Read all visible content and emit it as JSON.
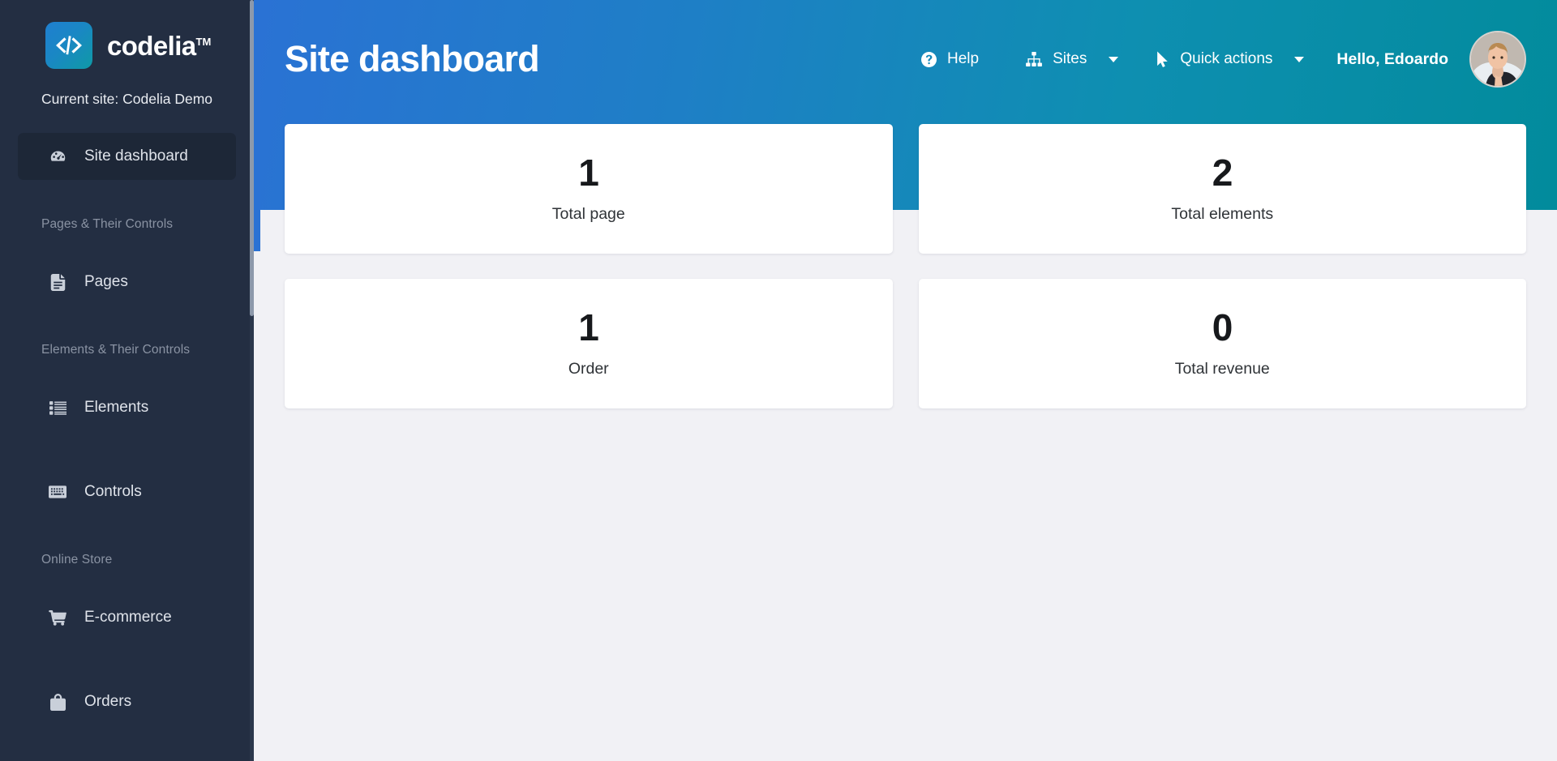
{
  "sidebar": {
    "logo": {
      "text": "codelia",
      "tm": "TM",
      "icon": "code-brackets-icon"
    },
    "current_site": "Current site: Codelia Demo",
    "primary_item": {
      "label": "Site dashboard",
      "icon": "gauge-icon",
      "active": true
    },
    "groups": [
      {
        "title": "Pages & Their Controls",
        "items": [
          {
            "label": "Pages",
            "icon": "document-icon"
          }
        ]
      },
      {
        "title": "Elements & Their Controls",
        "items": [
          {
            "label": "Elements",
            "icon": "list-icon"
          },
          {
            "label": "Controls",
            "icon": "keyboard-icon"
          }
        ]
      },
      {
        "title": "Online Store",
        "items": [
          {
            "label": "E-commerce",
            "icon": "shopping-cart-icon"
          },
          {
            "label": "Orders",
            "icon": "shopping-bag-icon"
          }
        ]
      }
    ]
  },
  "header": {
    "title": "Site dashboard",
    "help": {
      "label": "Help",
      "icon": "question-circle-icon"
    },
    "sites": {
      "label": "Sites",
      "icon": "sitemap-icon",
      "caret": "chevron-down-icon"
    },
    "quick_actions": {
      "label": "Quick actions",
      "icon": "cursor-arrow-icon",
      "caret": "chevron-down-icon"
    },
    "greeting": "Hello, Edoardo",
    "avatar": "user-avatar"
  },
  "stats": [
    {
      "value": "1",
      "label": "Total page"
    },
    {
      "value": "2",
      "label": "Total elements"
    },
    {
      "value": "1",
      "label": "Order"
    },
    {
      "value": "0",
      "label": "Total revenue"
    }
  ],
  "colors": {
    "sidebar_bg": "#232e42",
    "header_gradient_start": "#2a72d4",
    "header_gradient_end": "#028b9c",
    "content_bg": "#f1f1f5",
    "card_bg": "#ffffff"
  }
}
